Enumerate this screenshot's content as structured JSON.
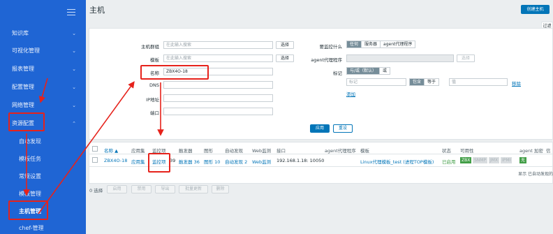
{
  "sidebar": {
    "items": [
      {
        "label": "知识库",
        "chevron": "⌄"
      },
      {
        "label": "可视化管理",
        "chevron": "⌄"
      },
      {
        "label": "报表管理",
        "chevron": "⌄"
      },
      {
        "label": "配置管理",
        "chevron": "⌄"
      },
      {
        "label": "网络管理",
        "chevron": "⌄"
      },
      {
        "label": "资源配置",
        "chevron": "⌃"
      }
    ],
    "subitems": [
      {
        "label": "自动发现"
      },
      {
        "label": "模板任务"
      },
      {
        "label": "常规设置"
      },
      {
        "label": "模板管理"
      },
      {
        "label": "主机管理"
      },
      {
        "label": "chef-管理"
      }
    ]
  },
  "header": {
    "title": "主机",
    "create_button": "创建主机"
  },
  "filter": {
    "tab_label": "过滤",
    "host_group_label": "主机群组",
    "host_group_placeholder": "在此输入搜索",
    "template_label": "模板",
    "template_placeholder": "在此输入搜索",
    "select_label": "选择",
    "name_label": "名称",
    "name_value": "ZBX4O-18",
    "dns_label": "DNS",
    "ip_label": "IP地址",
    "port_label": "端口",
    "monitored_by_label": "要监控什么",
    "monitored_by_options": [
      "任何",
      "服务器",
      "agent代理程序"
    ],
    "proxy_label": "agent代理程序",
    "proxy_select_label": "选择",
    "tags_label": "标记",
    "tags_operator_options": [
      "与/或（默认）",
      "或"
    ],
    "tag_placeholder": "标记",
    "tag_match_options": [
      "包含",
      "等于"
    ],
    "tag_value_placeholder": "值",
    "remove_label": "移除",
    "add_label": "添加",
    "apply_button": "应用",
    "reset_button": "重设"
  },
  "table": {
    "headers": [
      "名称 ▲",
      "应用集",
      "监控项",
      "触发器",
      "图形",
      "自动发现",
      "Web监测",
      "接口",
      "agent代理程序",
      "模板",
      "状态",
      "可用性",
      "agent 加密",
      "信"
    ],
    "rows": [
      {
        "name": "ZBX4O-18",
        "applications": "应用集",
        "items": "监控项",
        "items_count": "39",
        "triggers": "触发器 36",
        "graphs": "图形 10",
        "discovery": "自动发现 2",
        "web": "Web监测",
        "interface": "192.168.1.18: 10050",
        "proxy": "",
        "templates": "Linux代理模板_test (进程TOP模板)",
        "status": "已启用",
        "availability": [
          "ZBX",
          "SNMP",
          "JMX",
          "IPMI"
        ],
        "encryption": "无"
      }
    ],
    "footer_note": "显示 已自动发现的"
  },
  "bottom": {
    "selected": "0 选择",
    "actions": [
      "启用",
      "禁用",
      "导出",
      "批量更新",
      "删除"
    ]
  },
  "colors": {
    "sidebar": "#1f65d4",
    "accent": "#0275b8",
    "annotation": "#e6221b",
    "status_green": "#429e47"
  }
}
